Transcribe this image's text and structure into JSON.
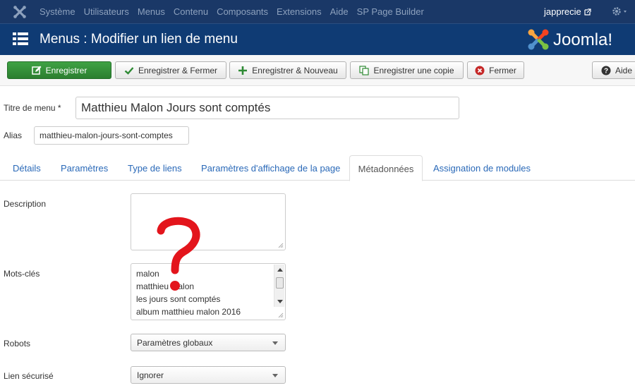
{
  "topbar": {
    "menu": [
      "Système",
      "Utilisateurs",
      "Menus",
      "Contenu",
      "Composants",
      "Extensions",
      "Aide",
      "SP Page Builder"
    ],
    "user": "japprecie"
  },
  "header": {
    "title": "Menus : Modifier un lien de menu",
    "brand": "Joomla!"
  },
  "toolbar": {
    "save": "Enregistrer",
    "save_close": "Enregistrer & Fermer",
    "save_new": "Enregistrer & Nouveau",
    "save_copy": "Enregistrer une copie",
    "close": "Fermer",
    "help": "Aide"
  },
  "form": {
    "title_label": "Titre de menu *",
    "title_value": "Matthieu Malon Jours sont comptés",
    "alias_label": "Alias",
    "alias_value": "matthieu-malon-jours-sont-comptes"
  },
  "tabs": [
    "Détails",
    "Paramètres",
    "Type de liens",
    "Paramètres d'affichage de la page",
    "Métadonnées",
    "Assignation de modules"
  ],
  "active_tab": "Métadonnées",
  "metadata": {
    "description_label": "Description",
    "description_value": "",
    "keywords_label": "Mots-clés",
    "keywords": [
      "malon",
      "matthieu malon",
      "les jours sont comptés",
      "album matthieu malon 2016"
    ],
    "robots_label": "Robots",
    "robots_value": "Paramètres globaux",
    "secure_label": "Lien sécurisé",
    "secure_value": "Ignorer"
  },
  "colors": {
    "topbar": "#1a3867",
    "header": "#0f3b74",
    "save_green": "#2f8a33",
    "link_blue": "#2a69b8",
    "annotation_red": "#e3151c"
  }
}
